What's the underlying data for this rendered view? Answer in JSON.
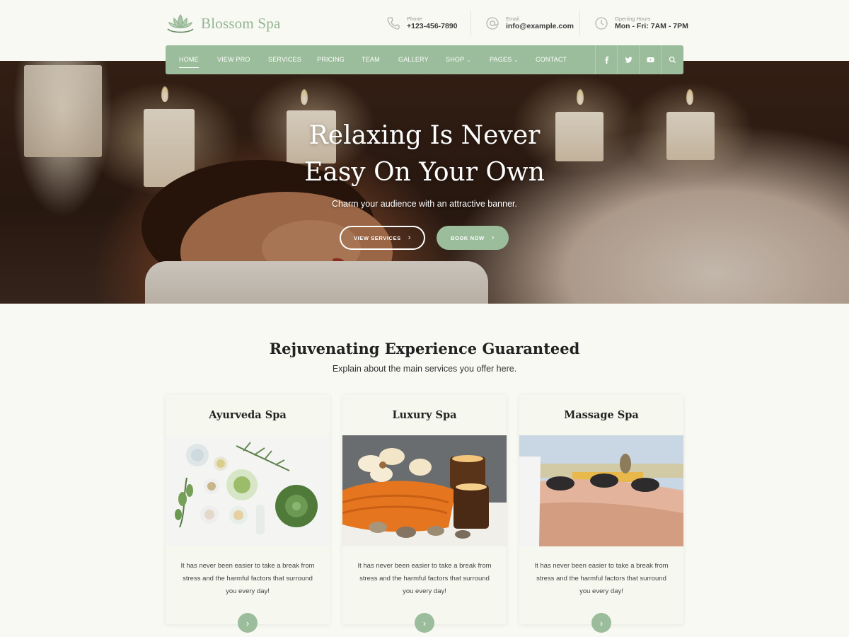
{
  "brand": {
    "name": "Blossom Spa",
    "accent": "#9bbd9b"
  },
  "contact": {
    "phone": {
      "label": "Phone",
      "value": "+123-456-7890",
      "icon": "phone-icon"
    },
    "email": {
      "label": "Email",
      "value": "info@example.com",
      "icon": "at-icon"
    },
    "hours": {
      "label": "Opening Hours",
      "value": "Mon - Fri: 7AM - 7PM",
      "icon": "clock-icon"
    }
  },
  "nav": {
    "items": [
      {
        "label": "HOME",
        "active": true
      },
      {
        "label": "VIEW PRO"
      },
      {
        "label": "SERVICES"
      },
      {
        "label": "PRICING"
      },
      {
        "label": "TEAM"
      },
      {
        "label": "GALLERY"
      },
      {
        "label": "SHOP",
        "dropdown": true
      },
      {
        "label": "PAGES",
        "dropdown": true
      },
      {
        "label": "CONTACT"
      }
    ],
    "social": [
      "facebook-icon",
      "twitter-icon",
      "youtube-icon",
      "search-icon"
    ]
  },
  "hero": {
    "title_line1": "Relaxing Is Never",
    "title_line2": "Easy On Your Own",
    "subtitle": "Charm your audience with an attractive banner.",
    "primary_button": "VIEW SERVICES",
    "secondary_button": "BOOK NOW"
  },
  "services": {
    "title": "Rejuvenating Experience Guaranteed",
    "subtitle": "Explain about the main services you offer here.",
    "cards": [
      {
        "title": "Ayurveda Spa",
        "text": "It has never been easier to take a break from stress and the harmful factors that surround you every day!"
      },
      {
        "title": "Luxury Spa",
        "text": "It has never been easier to take a break from stress and the harmful factors that surround you every day!"
      },
      {
        "title": "Massage Spa",
        "text": "It has never been easier to take a break from stress and the harmful factors that surround you every day!"
      }
    ]
  }
}
